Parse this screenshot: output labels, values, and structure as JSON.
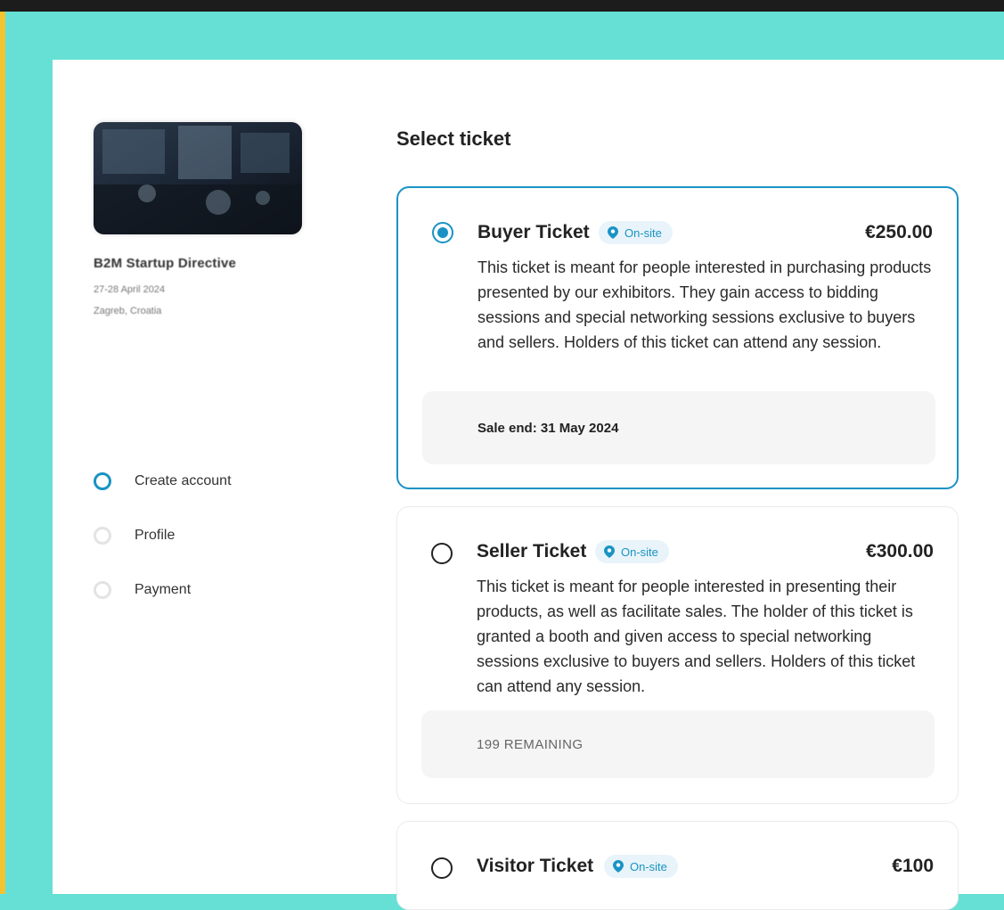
{
  "event": {
    "name": "B2M Startup Directive",
    "dates": "27-28 April 2024",
    "venue": "Zagreb, Croatia"
  },
  "steps": [
    {
      "label": "Create account",
      "state": "active"
    },
    {
      "label": "Profile",
      "state": "inactive"
    },
    {
      "label": "Payment",
      "state": "inactive"
    }
  ],
  "section_title": "Select ticket",
  "tickets": [
    {
      "name": "Buyer Ticket",
      "badge": "On-site",
      "price": "€250.00",
      "selected": true,
      "description": "This ticket is meant for people interested in purchasing products presented by our exhibitors. They gain access to bidding sessions and special networking sessions exclusive to buyers and sellers. Holders of this ticket can attend any session.",
      "info": "Sale end: 31 May 2024"
    },
    {
      "name": "Seller Ticket",
      "badge": "On-site",
      "price": "€300.00",
      "selected": false,
      "description": "This ticket is meant for people interested in presenting their products, as well as facilitate sales. The holder of this ticket is granted a booth and given access to special networking sessions exclusive to buyers and sellers. Holders of this ticket can attend any session.",
      "info": "199 REMAINING"
    },
    {
      "name": "Visitor Ticket",
      "badge": "On-site",
      "price": "€100",
      "selected": false
    }
  ],
  "colors": {
    "accent": "#1a93c4",
    "background": "#66e0d4",
    "topbar": "#1c1c1c",
    "left_strip": "#f4c430"
  },
  "icons": {
    "badge": "location-pin-icon"
  }
}
